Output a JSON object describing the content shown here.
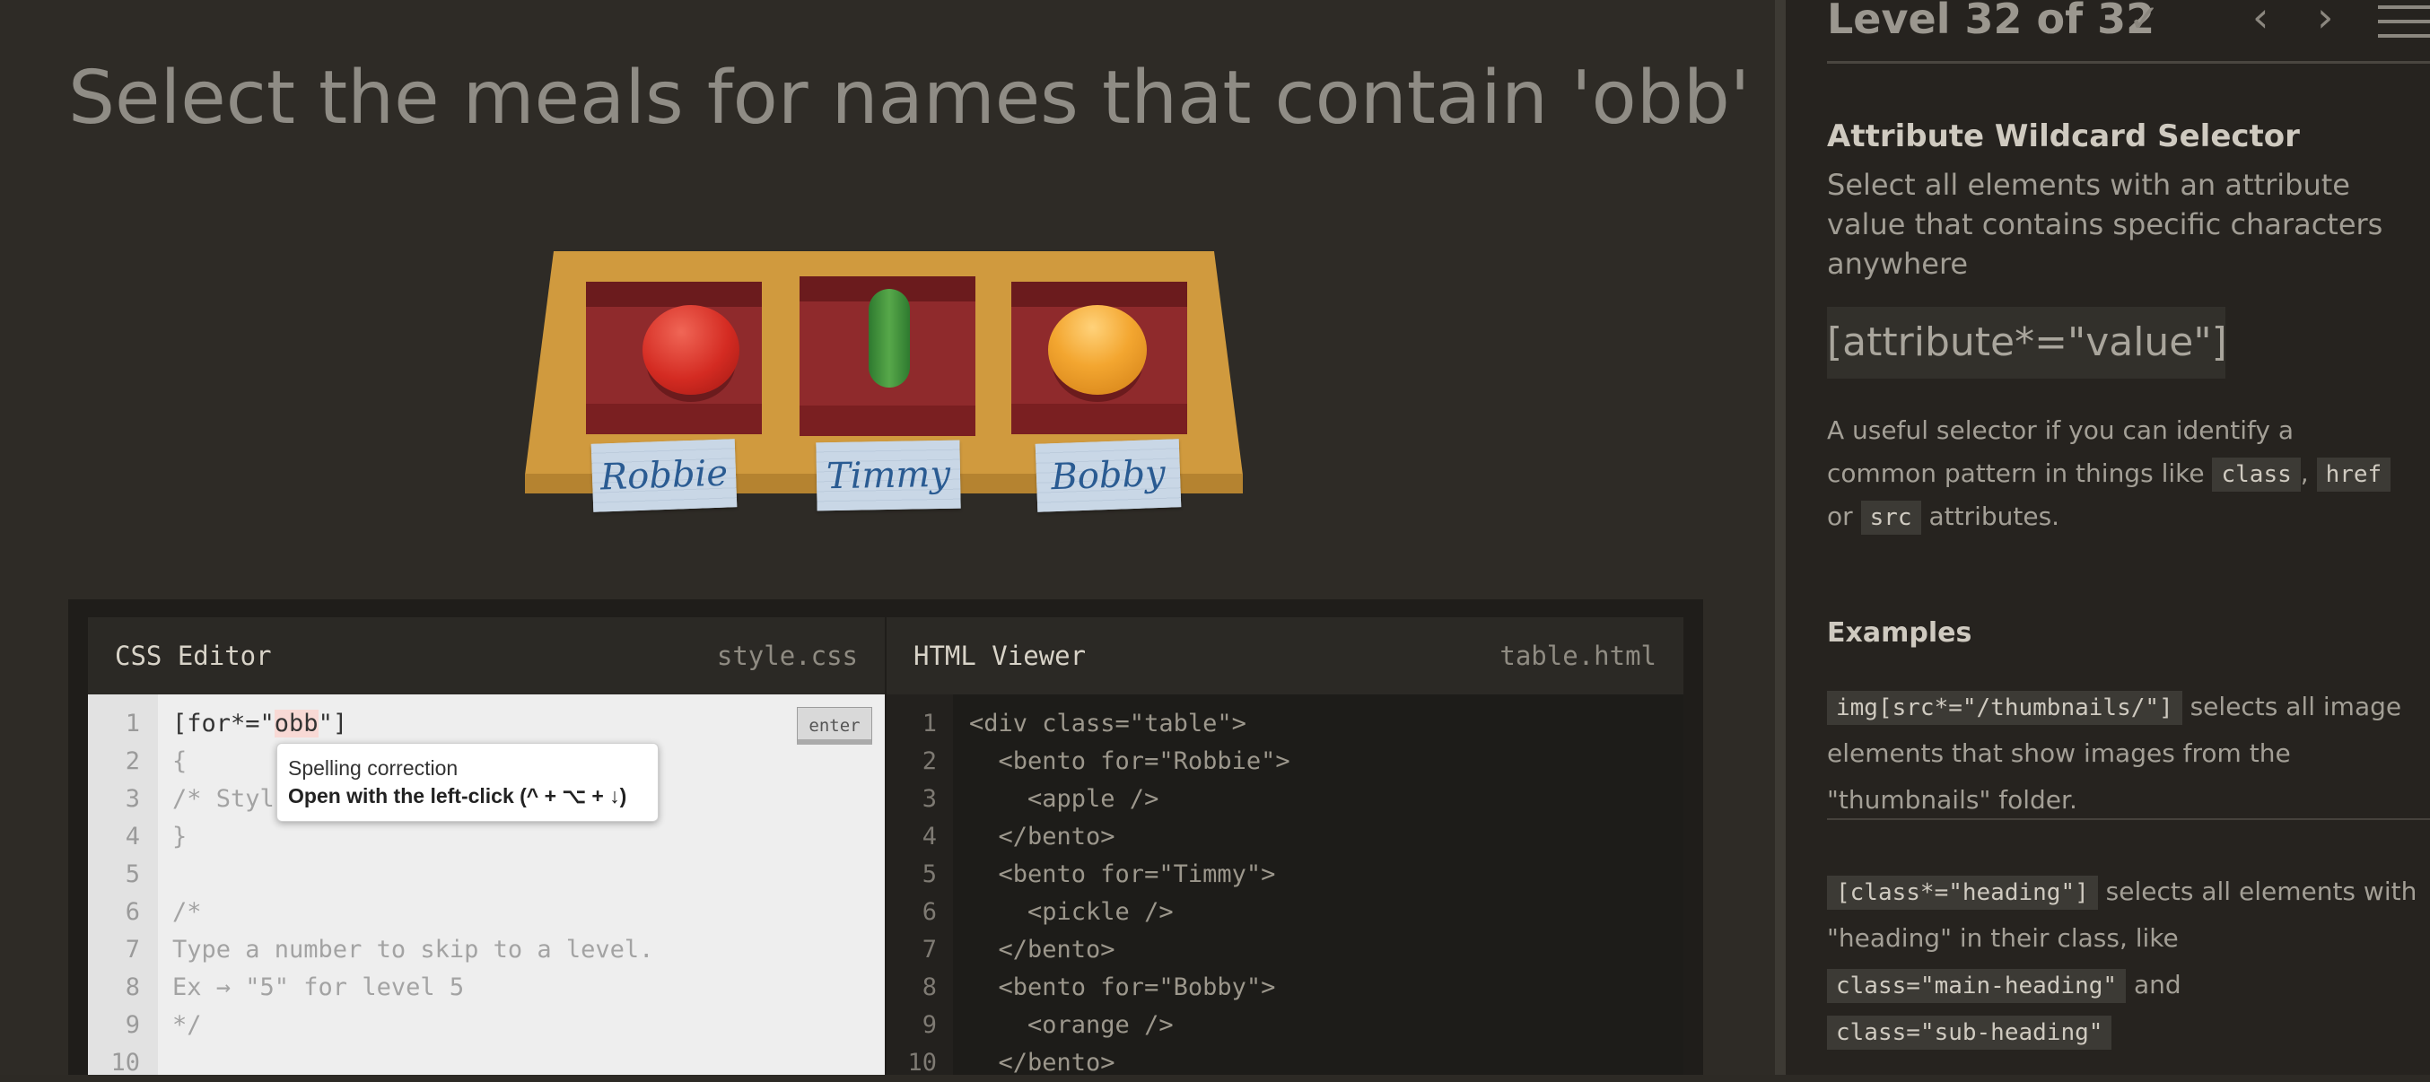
{
  "main": {
    "title": "Select the meals for names that contain 'obb'"
  },
  "table": {
    "tags": [
      "Robbie",
      "Timmy",
      "Bobby"
    ]
  },
  "css_editor": {
    "title": "CSS Editor",
    "file": "style.css",
    "line_numbers": "1\n2\n3\n4\n5\n6\n7\n8\n9\n10",
    "typed_prefix": "[for*=\"",
    "typed_highlight": "obb",
    "typed_suffix": "\"]",
    "rest": "\n{\n/* Styl\n}\n\n/*\nType a number to skip to a level.\nEx → \"5\" for level 5\n*/",
    "enter_label": "enter"
  },
  "tooltip": {
    "title": "Spelling correction",
    "subtitle": "Open with the left-click (^ + ⌥ + ↓)"
  },
  "html_viewer": {
    "title": "HTML Viewer",
    "file": "table.html",
    "line_numbers": "1\n2\n3\n4\n5\n6\n7\n8\n9\n10",
    "code": "<div class=\"table\">\n  <bento for=\"Robbie\">\n    <apple />\n  </bento>\n  <bento for=\"Timmy\">\n    <pickle />\n  </bento>\n  <bento for=\"Bobby\">\n    <orange />\n  </bento>"
  },
  "sidebar": {
    "level": "Level 32 of 32",
    "check": "✓",
    "prev": "‹",
    "next": "›",
    "selector_name": "Attribute Wildcard Selector",
    "selector_desc": "Select all elements with an attribute value that contains specific characters anywhere",
    "syntax": "[attribute*=\"value\"]",
    "help_prefix": "A useful selector if you can identify a common pattern in things like",
    "help_chip1": "class",
    "help_sep1": ",",
    "help_chip2": "href",
    "help_sep2": "or",
    "help_chip3": "src",
    "help_suffix": "attributes.",
    "examples_heading": "Examples",
    "ex1_code": "img[src*=\"/thumbnails/\"]",
    "ex1_text": "selects all image elements that show images from the \"thumbnails\" folder.",
    "ex2_code": "[class*=\"heading\"]",
    "ex2_text1": "selects all elements with \"heading\" in their class, like",
    "ex2_code2": "class=\"main-heading\"",
    "ex2_and": "and",
    "ex2_code3": "class=\"sub-heading\""
  }
}
